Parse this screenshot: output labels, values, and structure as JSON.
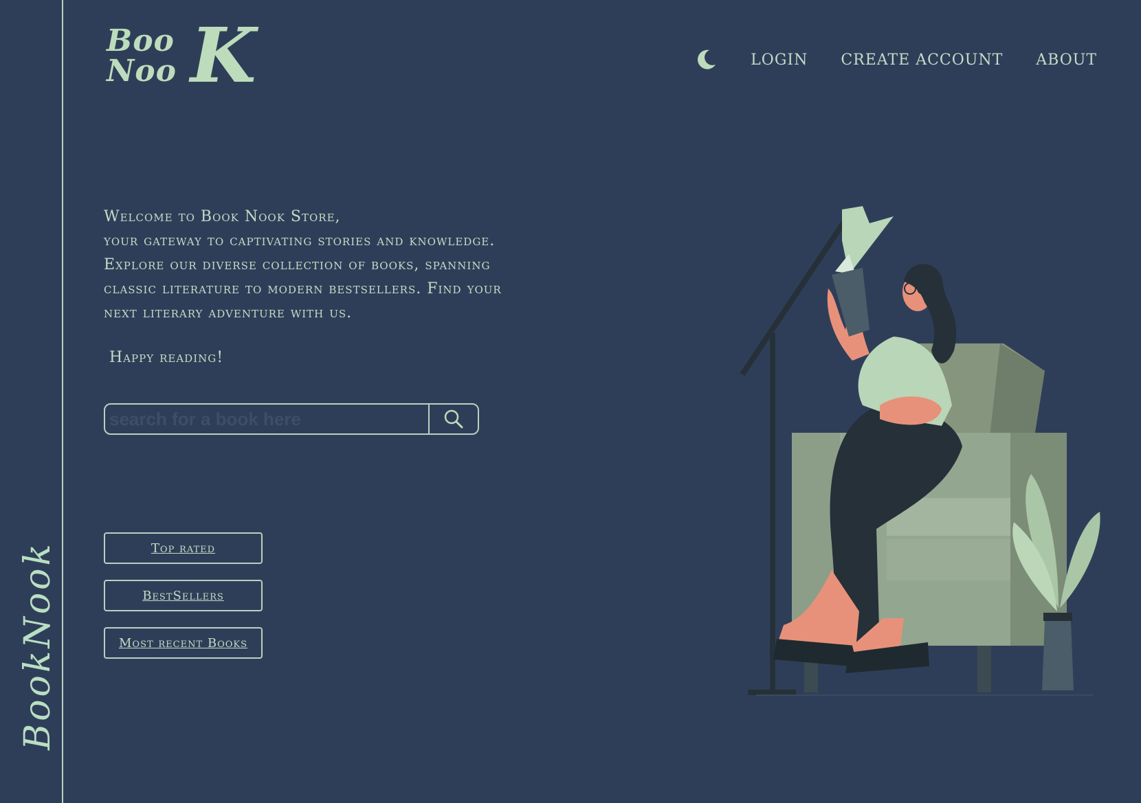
{
  "brand": {
    "logo_line1": "Boo",
    "logo_line2": "Noo",
    "logo_big": "K",
    "side_text": "BookNook"
  },
  "nav": {
    "theme_icon": "moon-icon",
    "login": "LOGIN",
    "create_account": "CREATE ACCOUNT",
    "about": "ABOUT"
  },
  "hero": {
    "intro": "Welcome to Book Nook Store,\nyour gateway to captivating stories and knowledge.\nExplore our diverse collection of books, spanning\nclassic literature to modern bestsellers. Find your\nnext literary adventure with us.",
    "closing": "Happy reading!"
  },
  "search": {
    "placeholder": "search for a book here",
    "icon": "search-icon"
  },
  "categories": [
    {
      "label": "Top rated"
    },
    {
      "label": "BestSellers"
    },
    {
      "label": "Most recent Books"
    }
  ],
  "colors": {
    "background": "#2f3e58",
    "accent": "#bcdcbc",
    "border": "#b9d1c2"
  }
}
